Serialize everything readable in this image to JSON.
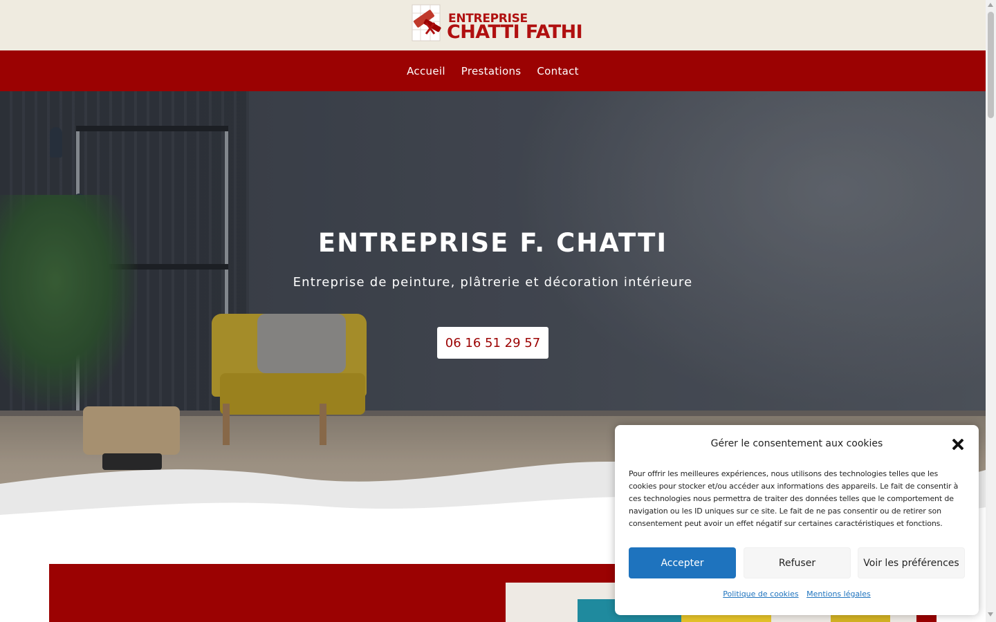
{
  "header": {
    "logo_line1": "ENTREPRISE",
    "logo_line2": "CHATTI FATHI",
    "logo_icon": "paint-roller-brush-logo"
  },
  "nav": {
    "items": [
      "Accueil",
      "Prestations",
      "Contact"
    ]
  },
  "hero": {
    "title": "ENTREPRISE F. CHATTI",
    "subtitle": "Entreprise de peinture, plâtrerie et décoration intérieure",
    "phone_button": "06 16 51 29 57"
  },
  "cookie": {
    "title": "Gérer le consentement aux cookies",
    "text": "Pour offrir les meilleures expériences, nous utilisons des technologies telles que les cookies pour stocker et/ou accéder aux informations des appareils. Le fait de consentir à ces technologies nous permettra de traiter des données telles que le comportement de navigation ou les ID uniques sur ce site. Le fait de ne pas consentir ou de retirer son consentement peut avoir un effet négatif sur certaines caractéristiques et fonctions.",
    "accept": "Accepter",
    "refuse": "Refuser",
    "preferences": "Voir les préférences",
    "link_cookies": "Politique de cookies",
    "link_legal": "Mentions légales"
  },
  "colors": {
    "brand_red": "#9b0202",
    "logo_bar_bg": "#efebe0",
    "accept_blue": "#1e73be"
  }
}
